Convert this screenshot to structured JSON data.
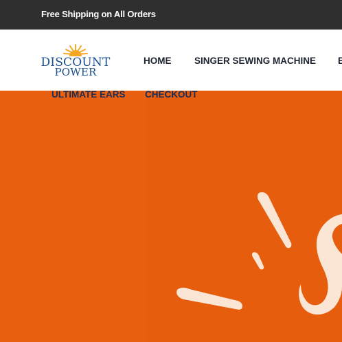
{
  "announcement": {
    "text": "Free Shipping on All Orders"
  },
  "logo": {
    "line1": "DISCOUNT",
    "line2": "POWER",
    "icon": "sun-icon"
  },
  "nav": {
    "home": "HOME",
    "singer": "SINGER SEWING MACHINE",
    "partial": "B",
    "ultimate_ears": "ULTIMATE EARS",
    "checkout": "CHECKOUT"
  },
  "colors": {
    "announcement_bg": "#2f2f2f",
    "hero_bg": "#e8600f",
    "logo_blue": "#1a4e8f",
    "sun": "#f5a623",
    "nav_text": "#1e2330"
  }
}
